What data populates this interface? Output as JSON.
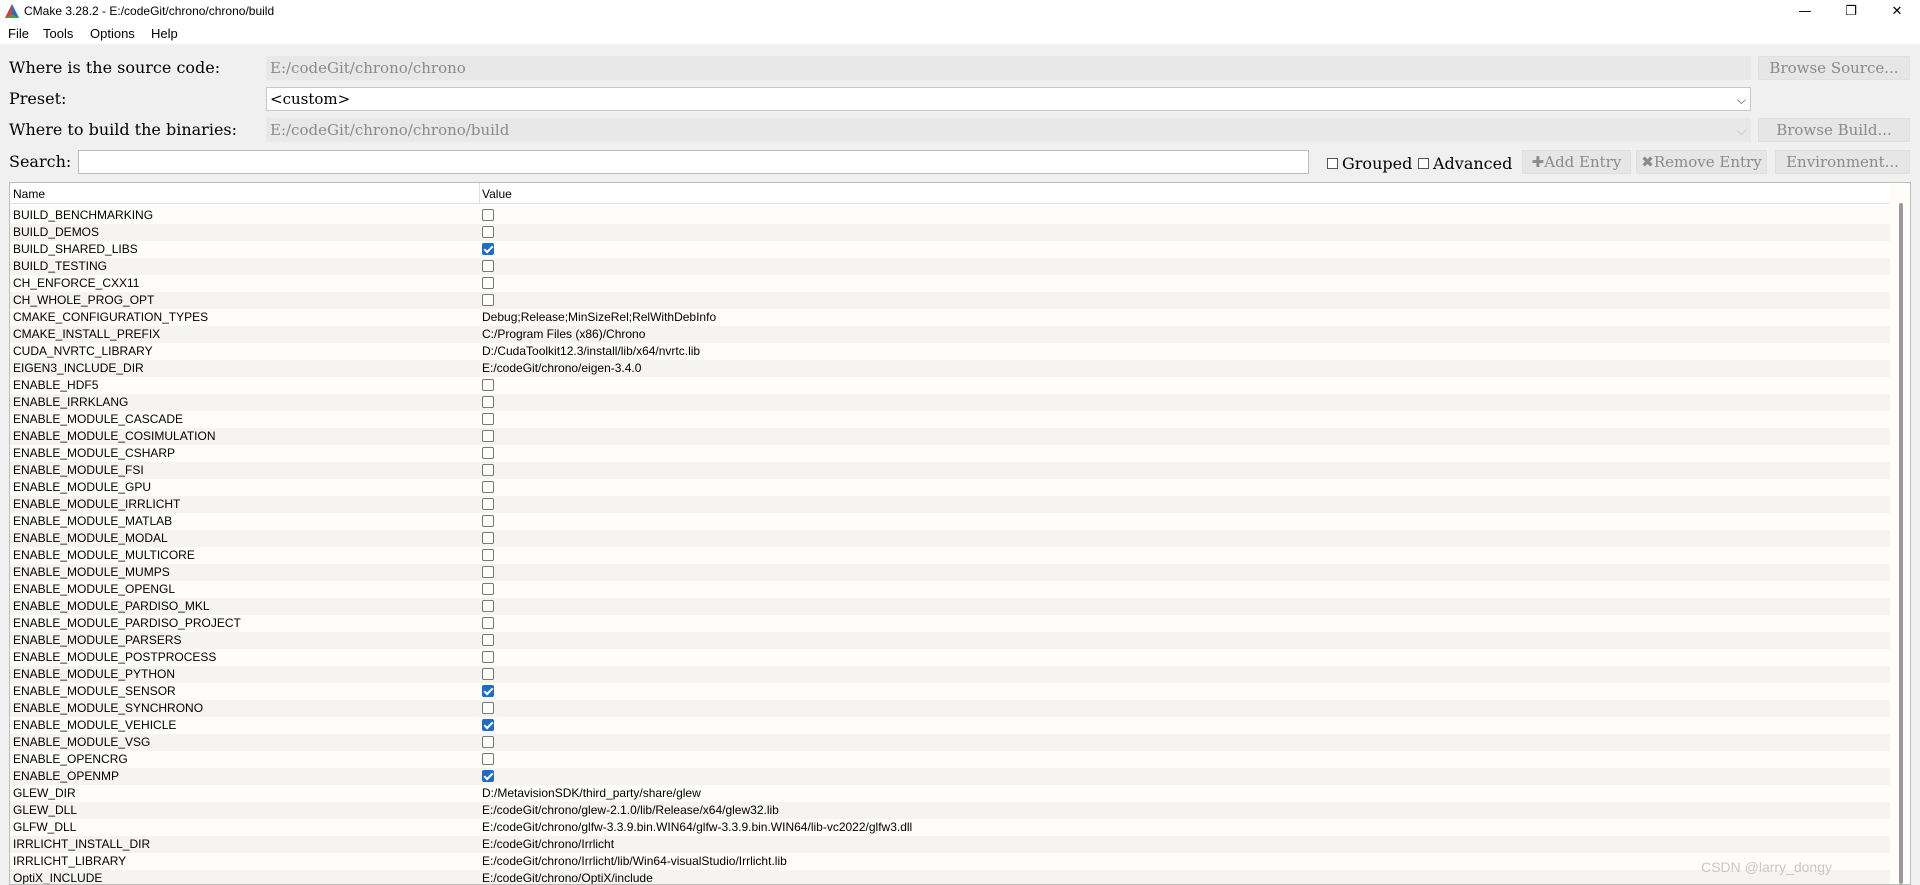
{
  "window": {
    "title": "CMake 3.28.2 - E:/codeGit/chrono/chrono/build",
    "minimize": "—",
    "maximize": "❐",
    "close": "✕"
  },
  "menu": [
    "File",
    "Tools",
    "Options",
    "Help"
  ],
  "source": {
    "label": "Where is the source code:",
    "value": "E:/codeGit/chrono/chrono",
    "browse": "Browse Source..."
  },
  "preset": {
    "label": "Preset:",
    "value": "<custom>"
  },
  "build": {
    "label": "Where to build the binaries:",
    "value": "E:/codeGit/chrono/chrono/build",
    "browse": "Browse Build..."
  },
  "search": {
    "label": "Search:",
    "value": ""
  },
  "options": {
    "grouped": "Grouped",
    "advanced": "Advanced",
    "add_entry": "Add Entry",
    "remove_entry": "Remove Entry",
    "environment": "Environment..."
  },
  "table": {
    "columns": [
      "Name",
      "Value"
    ],
    "rows": [
      {
        "name": "BUILD_BENCHMARKING",
        "type": "bool",
        "checked": false
      },
      {
        "name": "BUILD_DEMOS",
        "type": "bool",
        "checked": false
      },
      {
        "name": "BUILD_SHARED_LIBS",
        "type": "bool",
        "checked": true
      },
      {
        "name": "BUILD_TESTING",
        "type": "bool",
        "checked": false
      },
      {
        "name": "CH_ENFORCE_CXX11",
        "type": "bool",
        "checked": false
      },
      {
        "name": "CH_WHOLE_PROG_OPT",
        "type": "bool",
        "checked": false
      },
      {
        "name": "CMAKE_CONFIGURATION_TYPES",
        "type": "string",
        "value": "Debug;Release;MinSizeRel;RelWithDebInfo"
      },
      {
        "name": "CMAKE_INSTALL_PREFIX",
        "type": "string",
        "value": "C:/Program Files (x86)/Chrono"
      },
      {
        "name": "CUDA_NVRTC_LIBRARY",
        "type": "string",
        "value": "D:/CudaToolkit12.3/install/lib/x64/nvrtc.lib"
      },
      {
        "name": "EIGEN3_INCLUDE_DIR",
        "type": "string",
        "value": "E:/codeGit/chrono/eigen-3.4.0"
      },
      {
        "name": "ENABLE_HDF5",
        "type": "bool",
        "checked": false
      },
      {
        "name": "ENABLE_IRRKLANG",
        "type": "bool",
        "checked": false
      },
      {
        "name": "ENABLE_MODULE_CASCADE",
        "type": "bool",
        "checked": false
      },
      {
        "name": "ENABLE_MODULE_COSIMULATION",
        "type": "bool",
        "checked": false
      },
      {
        "name": "ENABLE_MODULE_CSHARP",
        "type": "bool",
        "checked": false
      },
      {
        "name": "ENABLE_MODULE_FSI",
        "type": "bool",
        "checked": false
      },
      {
        "name": "ENABLE_MODULE_GPU",
        "type": "bool",
        "checked": false
      },
      {
        "name": "ENABLE_MODULE_IRRLICHT",
        "type": "bool",
        "checked": false
      },
      {
        "name": "ENABLE_MODULE_MATLAB",
        "type": "bool",
        "checked": false
      },
      {
        "name": "ENABLE_MODULE_MODAL",
        "type": "bool",
        "checked": false
      },
      {
        "name": "ENABLE_MODULE_MULTICORE",
        "type": "bool",
        "checked": false
      },
      {
        "name": "ENABLE_MODULE_MUMPS",
        "type": "bool",
        "checked": false
      },
      {
        "name": "ENABLE_MODULE_OPENGL",
        "type": "bool",
        "checked": false
      },
      {
        "name": "ENABLE_MODULE_PARDISO_MKL",
        "type": "bool",
        "checked": false
      },
      {
        "name": "ENABLE_MODULE_PARDISO_PROJECT",
        "type": "bool",
        "checked": false
      },
      {
        "name": "ENABLE_MODULE_PARSERS",
        "type": "bool",
        "checked": false
      },
      {
        "name": "ENABLE_MODULE_POSTPROCESS",
        "type": "bool",
        "checked": false
      },
      {
        "name": "ENABLE_MODULE_PYTHON",
        "type": "bool",
        "checked": false
      },
      {
        "name": "ENABLE_MODULE_SENSOR",
        "type": "bool",
        "checked": true
      },
      {
        "name": "ENABLE_MODULE_SYNCHRONO",
        "type": "bool",
        "checked": false
      },
      {
        "name": "ENABLE_MODULE_VEHICLE",
        "type": "bool",
        "checked": true
      },
      {
        "name": "ENABLE_MODULE_VSG",
        "type": "bool",
        "checked": false
      },
      {
        "name": "ENABLE_OPENCRG",
        "type": "bool",
        "checked": false
      },
      {
        "name": "ENABLE_OPENMP",
        "type": "bool",
        "checked": true
      },
      {
        "name": "GLEW_DIR",
        "type": "string",
        "value": "D:/MetavisionSDK/third_party/share/glew"
      },
      {
        "name": "GLEW_DLL",
        "type": "string",
        "value": "E:/codeGit/chrono/glew-2.1.0/lib/Release/x64/glew32.lib"
      },
      {
        "name": "GLFW_DLL",
        "type": "string",
        "value": "E:/codeGit/chrono/glfw-3.3.9.bin.WIN64/glfw-3.3.9.bin.WIN64/lib-vc2022/glfw3.dll"
      },
      {
        "name": "IRRLICHT_INSTALL_DIR",
        "type": "string",
        "value": "E:/codeGit/chrono/Irrlicht"
      },
      {
        "name": "IRRLICHT_LIBRARY",
        "type": "string",
        "value": "E:/codeGit/chrono/Irrlicht/lib/Win64-visualStudio/Irrlicht.lib"
      },
      {
        "name": "OptiX_INCLUDE",
        "type": "string",
        "value": "E:/codeGit/chrono/OptiX/include"
      }
    ]
  },
  "watermark": "CSDN @larry_dongy",
  "colors": {
    "checked": "#1e6bc9",
    "disabled_text": "#8a8a8a"
  }
}
